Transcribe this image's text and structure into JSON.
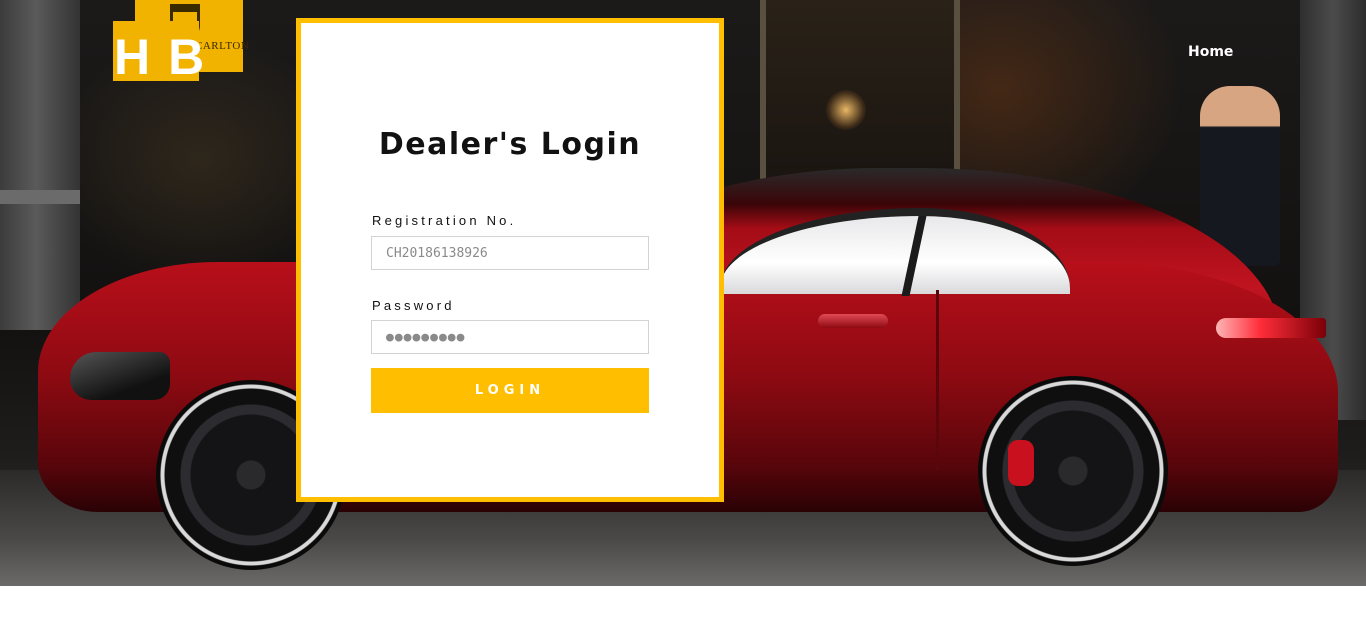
{
  "brand": {
    "logo_text": "HB",
    "color": "#f2b300",
    "background_sign_text": "CARLTON"
  },
  "nav": {
    "home_label": "Home"
  },
  "login": {
    "title": "Dealer's Login",
    "registration_label": "Registration No.",
    "registration_placeholder": "CH20186138926",
    "password_label": "Password",
    "password_placeholder": "●●●●●●●●●",
    "button_label": "LOGIN"
  },
  "colors": {
    "accent": "#ffbf00",
    "card_bg": "#ffffff",
    "car": "#b80f1a"
  }
}
